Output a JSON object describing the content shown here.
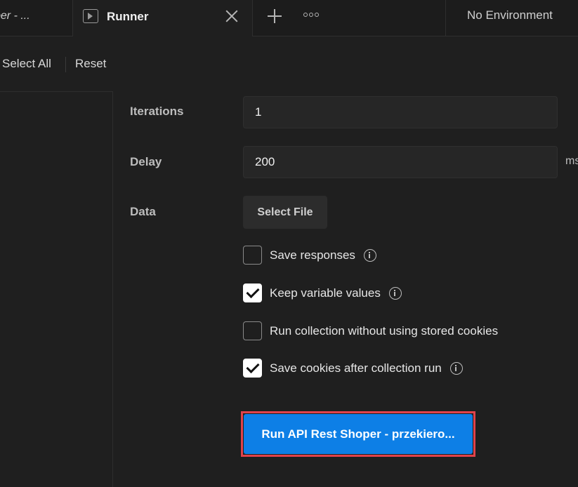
{
  "tabs": {
    "prev_tab_label": "per - ...",
    "active_tab_label": "Runner",
    "environment_label": "No Environment"
  },
  "toolbar": {
    "select_all_label": "Select All",
    "reset_label": "Reset"
  },
  "form": {
    "iterations_label": "Iterations",
    "iterations_value": "1",
    "delay_label": "Delay",
    "delay_value": "200",
    "delay_unit": "ms",
    "data_label": "Data",
    "select_file_label": "Select File"
  },
  "options": [
    {
      "label": "Save responses",
      "checked": false,
      "info": true
    },
    {
      "label": "Keep variable values",
      "checked": true,
      "info": true
    },
    {
      "label": "Run collection without using stored cookies",
      "checked": false,
      "info": false
    },
    {
      "label": "Save cookies after collection run",
      "checked": true,
      "info": true
    }
  ],
  "run_button_label": "Run API Rest Shoper - przekiero...",
  "colors": {
    "accent": "#0d7fe6",
    "highlight": "#e0424b",
    "background": "#1f1f1f"
  }
}
